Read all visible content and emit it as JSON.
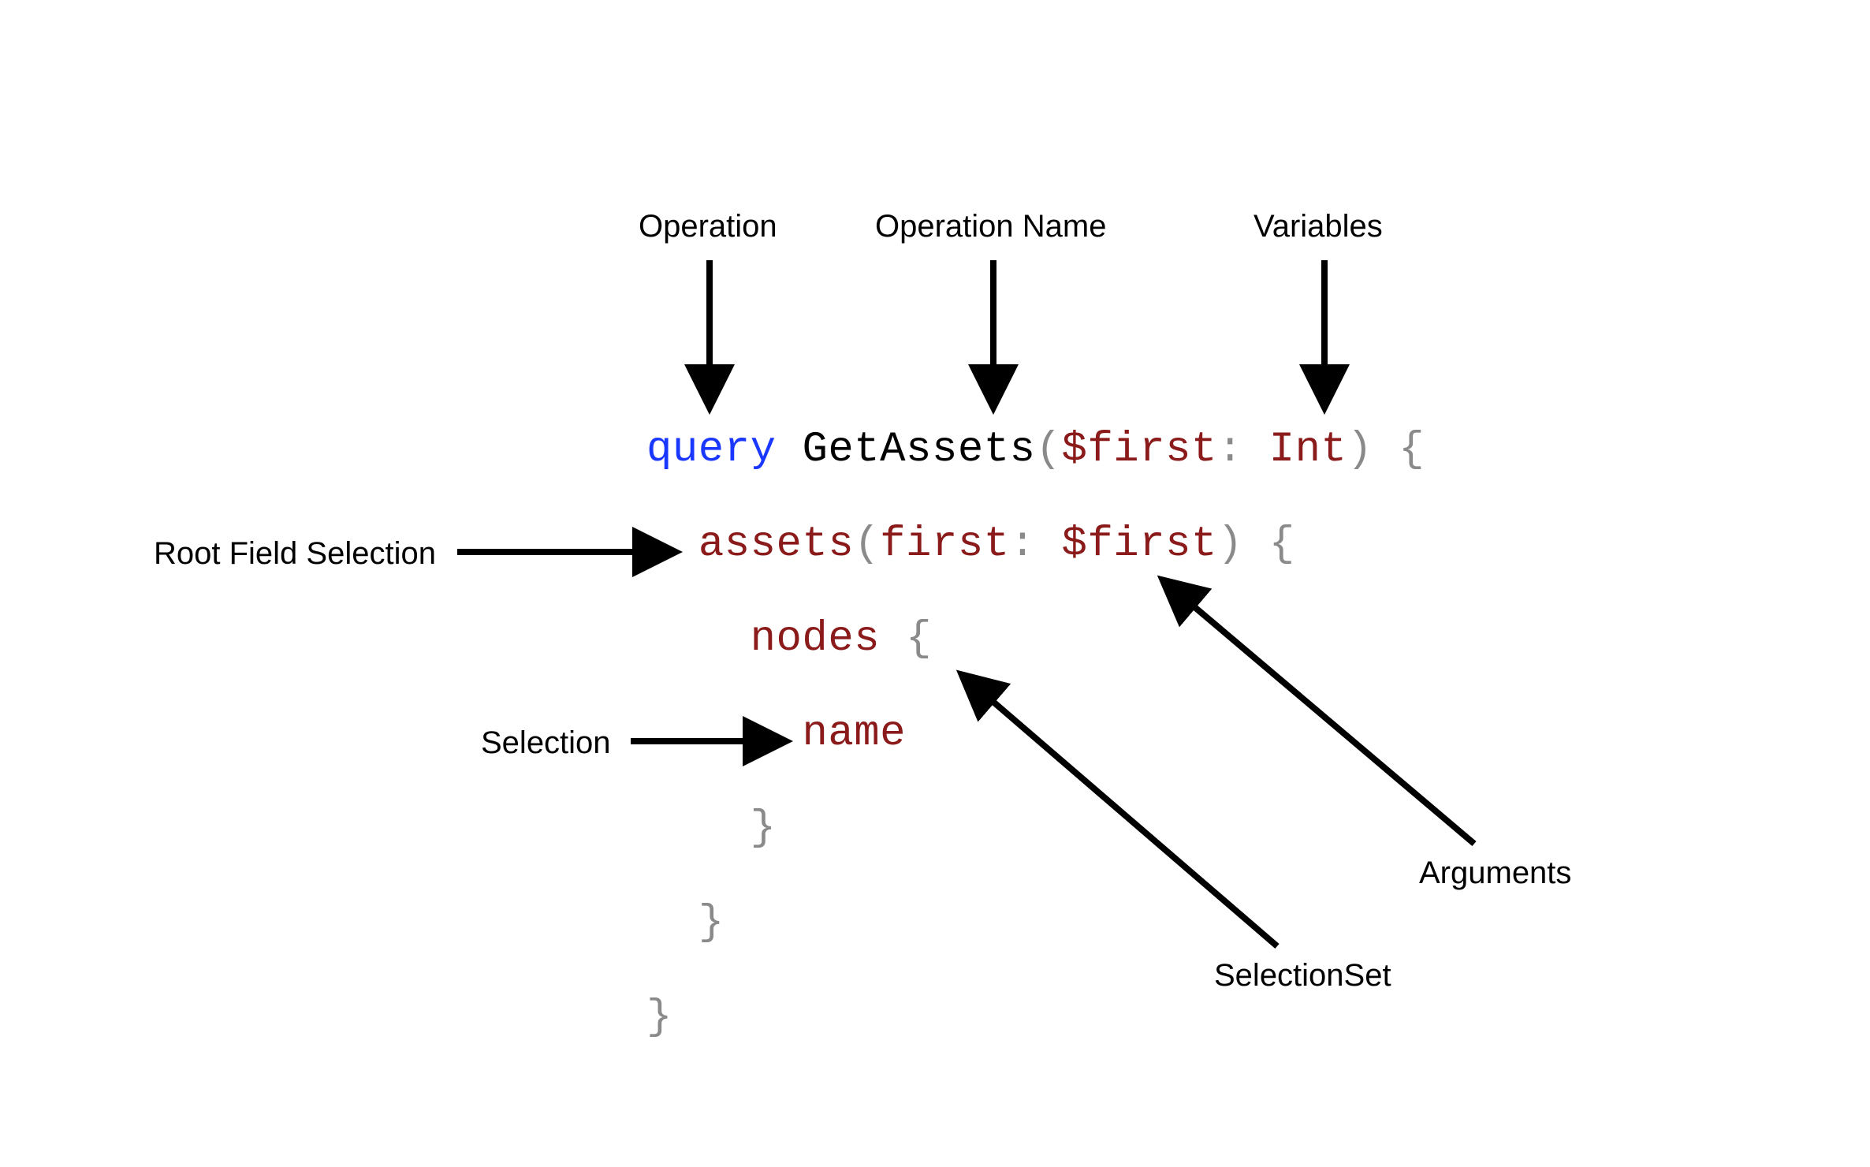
{
  "labels": {
    "operation": "Operation",
    "operation_name": "Operation Name",
    "variables": "Variables",
    "root_field_selection": "Root Field Selection",
    "selection": "Selection",
    "arguments": "Arguments",
    "selection_set": "SelectionSet"
  },
  "code": {
    "line1": {
      "keyword": "query",
      "space1": " ",
      "op_name": "GetAssets",
      "paren_open": "(",
      "var_name": "$first",
      "colon": ":",
      "space2": " ",
      "type": "Int",
      "paren_close": ")",
      "space3": " ",
      "brace_open": "{"
    },
    "line2": {
      "indent": "  ",
      "field": "assets",
      "paren_open": "(",
      "arg_name": "first",
      "colon": ":",
      "space": " ",
      "arg_value": "$first",
      "paren_close": ")",
      "space2": " ",
      "brace_open": "{"
    },
    "line3": {
      "indent": "    ",
      "field": "nodes",
      "space": " ",
      "brace_open": "{"
    },
    "line4": {
      "indent": "      ",
      "field": "name"
    },
    "line5": {
      "indent": "    ",
      "brace_close": "}"
    },
    "line6": {
      "indent": "  ",
      "brace_close": "}"
    },
    "line7": {
      "indent": "",
      "brace_close": "}"
    }
  }
}
